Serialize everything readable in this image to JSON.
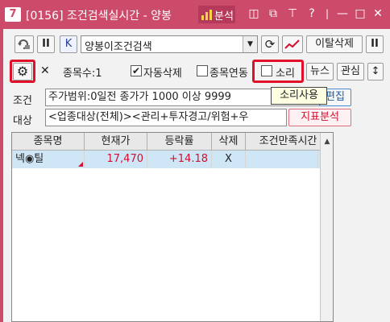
{
  "window": {
    "number": "7",
    "title": "[0156] 조건검색실시간 - 양봉",
    "analysis_label": "분석",
    "buttons": {
      "layout": "◫",
      "restore": "⧉",
      "pin": "⊤",
      "help": "?",
      "minimize": "—",
      "maximize": "□",
      "close": "✕"
    }
  },
  "toolbar": {
    "pause_label": "II",
    "k_label": "K",
    "condition_name": "양봉이조건검색",
    "exit_delete_label": "이탈삭제",
    "pause2_label": "II"
  },
  "options": {
    "count_label": "종목수:1",
    "auto_delete_label": "자동삭제",
    "auto_delete_checked": "✔",
    "stock_link_label": "종목연동",
    "sound_label": "소리",
    "news_label": "뉴스",
    "interest_label": "관심",
    "sort_label": "↕"
  },
  "condition": {
    "label": "조건",
    "value": "주가범위:0일전 종가가 1000 이상 9999",
    "edit_label": "편집"
  },
  "target": {
    "label": "대상",
    "value": "<업종대상(전체)><관리+투자경고/위험+우",
    "indicator_label": "지표분석"
  },
  "tooltip": "소리사용",
  "table": {
    "headers": [
      "종목명",
      "현재가",
      "등락률",
      "삭제",
      "조건만족시간"
    ],
    "rows": [
      {
        "name": "넥◉틸",
        "price": "17,470",
        "change": "+14.18",
        "delete": "X",
        "time": ""
      }
    ]
  },
  "colors": {
    "title_bar": "#cc4a6a",
    "highlight": "#e0102a",
    "row_selected": "#cfe6f6",
    "price_up": "#d01030",
    "indicator_text": "#d01030"
  }
}
